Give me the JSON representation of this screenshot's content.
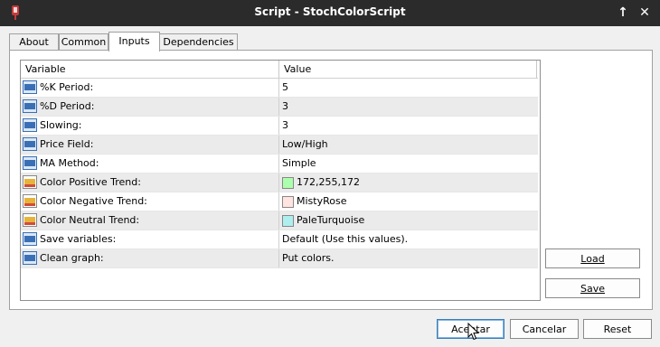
{
  "window": {
    "title": "Script - StochColorScript",
    "pin_glyph": "↑",
    "close_glyph": "✕"
  },
  "tabs": [
    {
      "label": "About"
    },
    {
      "label": "Common"
    },
    {
      "label": "Inputs"
    },
    {
      "label": "Dependencies"
    }
  ],
  "grid": {
    "col_variable": "Variable",
    "col_value": "Value",
    "rows": [
      {
        "icon": "number-icon",
        "name": "%K Period:",
        "value": "5"
      },
      {
        "icon": "number-icon",
        "name": "%D Period:",
        "value": "3"
      },
      {
        "icon": "number-icon",
        "name": "Slowing:",
        "value": "3"
      },
      {
        "icon": "number-icon",
        "name": "Price Field:",
        "value": "Low/High"
      },
      {
        "icon": "number-icon",
        "name": "MA Method:",
        "value": "Simple"
      },
      {
        "icon": "color-icon",
        "name": "Color Positive Trend:",
        "value": "172,255,172",
        "swatch": "#acffac"
      },
      {
        "icon": "color-icon",
        "name": "Color Negative Trend:",
        "value": "MistyRose",
        "swatch": "#ffe4e1"
      },
      {
        "icon": "color-icon",
        "name": "Color Neutral Trend:",
        "value": "PaleTurquoise",
        "swatch": "#afeeee"
      },
      {
        "icon": "number-icon",
        "name": "Save variables:",
        "value": "Default (Use this values)."
      },
      {
        "icon": "number-icon",
        "name": "Clean graph:",
        "value": "Put colors."
      }
    ]
  },
  "side_buttons": {
    "load": "Load",
    "save": "Save"
  },
  "footer": {
    "accept": "Aceptar",
    "cancel": "Cancelar",
    "reset": "Reset"
  },
  "colors": {
    "titlebar": "#2b2b2b",
    "row_alt": "#ebebeb",
    "number_icon": "#3a6fb5",
    "color_icon": "#e8b33a"
  }
}
